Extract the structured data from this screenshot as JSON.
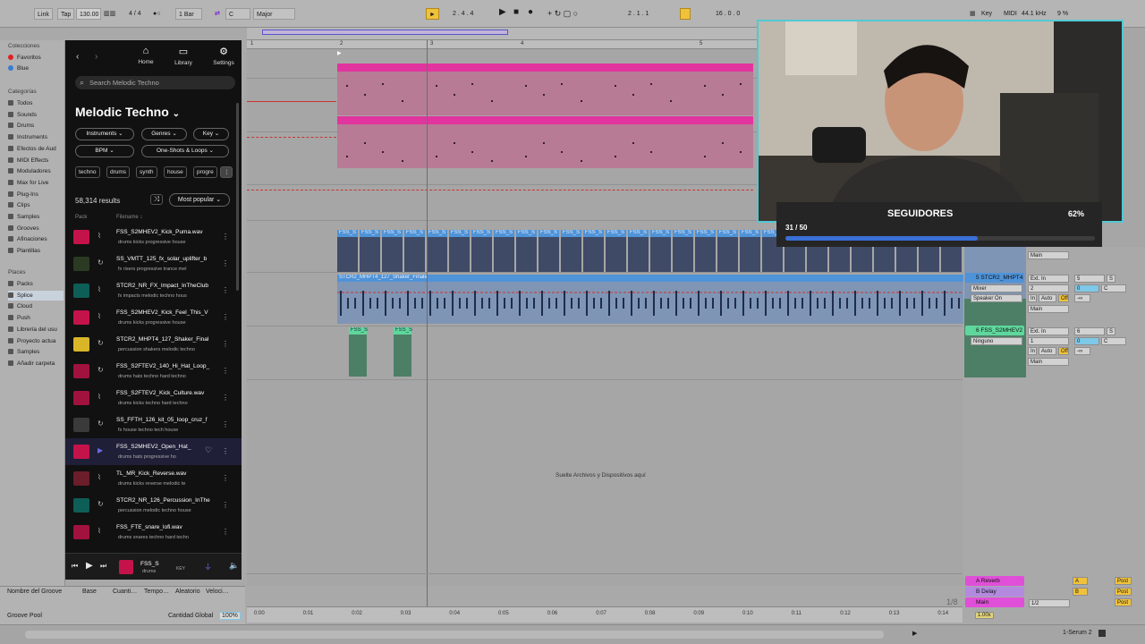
{
  "transport": {
    "link": "Link",
    "tap": "Tap",
    "tempo": "130.00",
    "signature": "4 / 4",
    "quantize": "1 Bar",
    "key": "C",
    "scale": "Major",
    "position": "2 . 4 . 4",
    "loop_start": "2 . 1 . 1",
    "loop_length": "16 . 0 . 0",
    "key_label": "Key",
    "midi_label": "MIDI",
    "sample_rate": "44.1 kHz",
    "cpu": "9 %"
  },
  "left_panel": {
    "collections_header": "Colecciones",
    "collections": [
      "Favoritos",
      "Blue"
    ],
    "categories_header": "Categorías",
    "categories": [
      "Todos",
      "Sounds",
      "Drums",
      "Instruments",
      "Efectos de Aud",
      "MIDI Effects",
      "Moduladores",
      "Max for Live",
      "Plug-Ins",
      "Clips",
      "Samples",
      "Grooves",
      "Afinaciones",
      "Plantillas"
    ],
    "places_header": "Places",
    "places": [
      "Packs",
      "Splice",
      "Cloud",
      "Push",
      "Librería del usu",
      "Proyecto actua",
      "Samples",
      "Añadir carpeta"
    ]
  },
  "splice": {
    "nav": [
      "Home",
      "Library",
      "Settings"
    ],
    "search_placeholder": "Search Melodic Techno",
    "title": "Melodic Techno",
    "filters": [
      "Instruments",
      "Genres",
      "Key",
      "BPM",
      "One-Shots & Loops"
    ],
    "tags": [
      "techno",
      "drums",
      "synth",
      "house",
      "progre"
    ],
    "results": "58,314 results",
    "sort": "Most popular",
    "col_pack": "Pack",
    "col_filename": "Filename",
    "rows": [
      {
        "name": "FSS_S2MHEV2_Kick_Puma.wav",
        "tags": "drums   kicks   progressive house",
        "color": "#c4134a"
      },
      {
        "name": "SS_VMTT_125_fx_solar_uplifter_b",
        "tags": "fx   risers   progressive trance   mel",
        "color": "#2b3a22"
      },
      {
        "name": "STCR2_NR_FX_Impact_InTheClub",
        "tags": "fx   impacts   melodic techno   hous",
        "color": "#0d5e57"
      },
      {
        "name": "FSS_S2MHEV2_Kick_Feel_This_V",
        "tags": "drums   kicks   progressive house",
        "color": "#c4134a"
      },
      {
        "name": "STCR2_MHPT4_127_Shaker_Final",
        "tags": "percussion   shakers   melodic techno",
        "color": "#d8b628"
      },
      {
        "name": "FSS_S2FTEV2_140_Hi_Hat_Loop_",
        "tags": "drums   hats   techno   hard techno",
        "color": "#a1123f"
      },
      {
        "name": "FSS_S2FTEV2_Kick_Culture.wav",
        "tags": "drums   kicks   techno   hard techno",
        "color": "#a1123f"
      },
      {
        "name": "SS_FFTH_126_kit_05_loop_cruz_f",
        "tags": "fx   house   techno   tech house",
        "color": "#3a3a3a"
      },
      {
        "name": "FSS_S2MHEV2_Open_Hat_",
        "tags": "drums   hats   progressive ho",
        "color": "#c4134a"
      },
      {
        "name": "TL_MR_Kick_Reverse.wav",
        "tags": "drums   kicks   reverse   melodic te",
        "color": "#6b1d2a"
      },
      {
        "name": "STCR2_NR_126_Percussion_InThe",
        "tags": "percussion   melodic techno   house",
        "color": "#0d5e57"
      },
      {
        "name": "FSS_FTE_snare_lofi.wav",
        "tags": "drums   snares   techno   hard techn",
        "color": "#a1123f"
      }
    ],
    "player": {
      "name": "FSS_S",
      "tags": "drums",
      "key": "KEY"
    }
  },
  "arrangement": {
    "ruler": [
      "1",
      "2",
      "3",
      "4",
      "5"
    ],
    "clip_blue_title": "STCR2_MHPT4_127_Shaker_Finale",
    "clip_green_a": "FSS_S",
    "clip_green_b": "FSS_S",
    "clip_stack": "FSS_S",
    "drop_text": "Suelte Archivos y Dispositivos aquí",
    "fraction": "1/8"
  },
  "mixer": {
    "track5_name": "5 STCR2_MHPT4",
    "track6_name": "6 FSS_S2MHEV2",
    "input": "Ext. In",
    "mixer_label": "Mixer",
    "speaker": "Speaker On",
    "ninguno": "Ninguno",
    "main": "Main",
    "ch1": "1",
    "ch2": "2",
    "num5": "5",
    "num6": "6",
    "in": "In",
    "auto": "Auto",
    "off": "Off",
    "inf": "-∞",
    "c": "C",
    "s": "S",
    "zero": "0",
    "returns": [
      "A Reverb",
      "B Delay",
      "Main"
    ],
    "ret_letters": [
      "A",
      "B"
    ],
    "post": "Post",
    "half": "1/2"
  },
  "groove": {
    "headers": [
      "Nombre del Groove",
      "Base",
      "Cuanti…",
      "Tempo…",
      "Aleatorio",
      "Veloci…"
    ],
    "pool": "Groove Pool",
    "global": "Cantidad Global",
    "amount": "100%"
  },
  "timeline": [
    "0:00",
    "0:01",
    "0:02",
    "0:03",
    "0:04",
    "0:05",
    "0:06",
    "0:07",
    "0:08",
    "0:09",
    "0:10",
    "0:11",
    "0:12",
    "0:13",
    "0:14"
  ],
  "status": {
    "device": "1-Serum 2"
  },
  "followers": {
    "title": "SEGUIDORES",
    "count": "31 / 50",
    "percent": "62%",
    "progress": 0.62
  }
}
